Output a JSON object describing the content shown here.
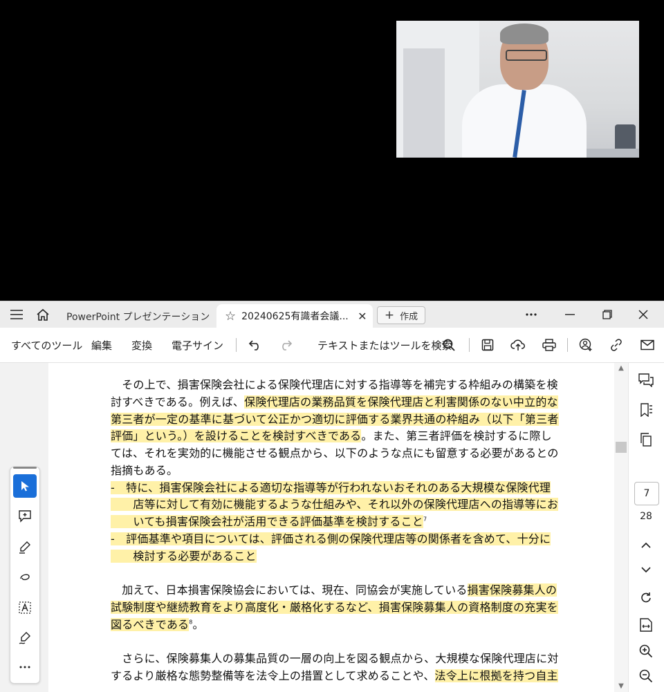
{
  "titlebar": {
    "tab_inactive": "PowerPoint プレゼンテーション",
    "tab_active": "20240625有識者会議...",
    "new_tab_label": "作成"
  },
  "toolbar": {
    "all_tools": "すべてのツール",
    "edit": "編集",
    "convert": "変換",
    "esign": "電子サイン",
    "search_placeholder": "テキストまたはツールを検索"
  },
  "document": {
    "lines": [
      {
        "parts": [
          {
            "t": "　その上で、損害保険会社による保険代理店に対する指導等を補完する枠組みの構築を検",
            "h": false
          }
        ]
      },
      {
        "parts": [
          {
            "t": "討すべきである。例えば、",
            "h": false
          },
          {
            "t": "保険代理店の業務品質を保険代理店と利害関係のない中立的な",
            "h": true
          }
        ]
      },
      {
        "parts": [
          {
            "t": "第三者が一定の基準に基づいて公正かつ適切に評価する業界共通の枠組み（以下「第三者",
            "h": true
          }
        ]
      },
      {
        "parts": [
          {
            "t": "評価」という。）を設けることを検討すべきである",
            "h": true
          },
          {
            "t": "。また、第三者評価を検討するに際し",
            "h": false
          }
        ]
      },
      {
        "parts": [
          {
            "t": "ては、それを実効的に機能させる観点から、以下のような点にも留意する必要があるとの",
            "h": false
          }
        ]
      },
      {
        "parts": [
          {
            "t": "指摘もある。",
            "h": false
          }
        ]
      },
      {
        "parts": [
          {
            "t": "‐　特に、損害保険会社による適切な指導等が行われないおそれのある大規模な保険代理",
            "h": true
          }
        ]
      },
      {
        "parts": [
          {
            "t": "　　店等に対して有効に機能するような仕組みや、それ以外の保険代理店への指導等にお",
            "h": true
          }
        ]
      },
      {
        "parts": [
          {
            "t": "　　いても損害保険会社が活用できる評価基準を検討すること",
            "h": true
          },
          {
            "t": "7",
            "h": false,
            "sup": true
          }
        ]
      },
      {
        "parts": [
          {
            "t": "‐　評価基準や項目については、評価される側の保険代理店等の関係者を含めて、十分に",
            "h": true
          }
        ]
      },
      {
        "parts": [
          {
            "t": "　　検討する必要があること",
            "h": true
          }
        ]
      },
      {
        "parts": [
          {
            "t": "",
            "h": false
          }
        ]
      },
      {
        "parts": [
          {
            "t": "　加えて、日本損害保険協会においては、現在、同協会が実施している",
            "h": false
          },
          {
            "t": "損害保険募集人の",
            "h": true
          }
        ]
      },
      {
        "parts": [
          {
            "t": "試験制度や継続教育をより高度化・厳格化するなど、損害保険募集人の資格制度の充実を",
            "h": true
          }
        ]
      },
      {
        "parts": [
          {
            "t": "図るべきである",
            "h": true
          },
          {
            "t": "8",
            "h": false,
            "sup": true
          },
          {
            "t": "。",
            "h": false
          }
        ]
      },
      {
        "parts": [
          {
            "t": "",
            "h": false
          }
        ]
      },
      {
        "parts": [
          {
            "t": "　さらに、保険募集人の募集品質の一層の向上を図る観点から、大規模な保険代理店に対",
            "h": false
          }
        ]
      },
      {
        "parts": [
          {
            "t": "するより厳格な態勢整備等を法令上の措置として求めることや、",
            "h": false
          },
          {
            "t": "法令上に根拠を持つ自主",
            "h": true
          }
        ]
      }
    ]
  },
  "navigation": {
    "current_page": "7",
    "total_pages": "28"
  },
  "colors": {
    "highlight": "#fff1a8",
    "accent": "#1a6fd9"
  }
}
